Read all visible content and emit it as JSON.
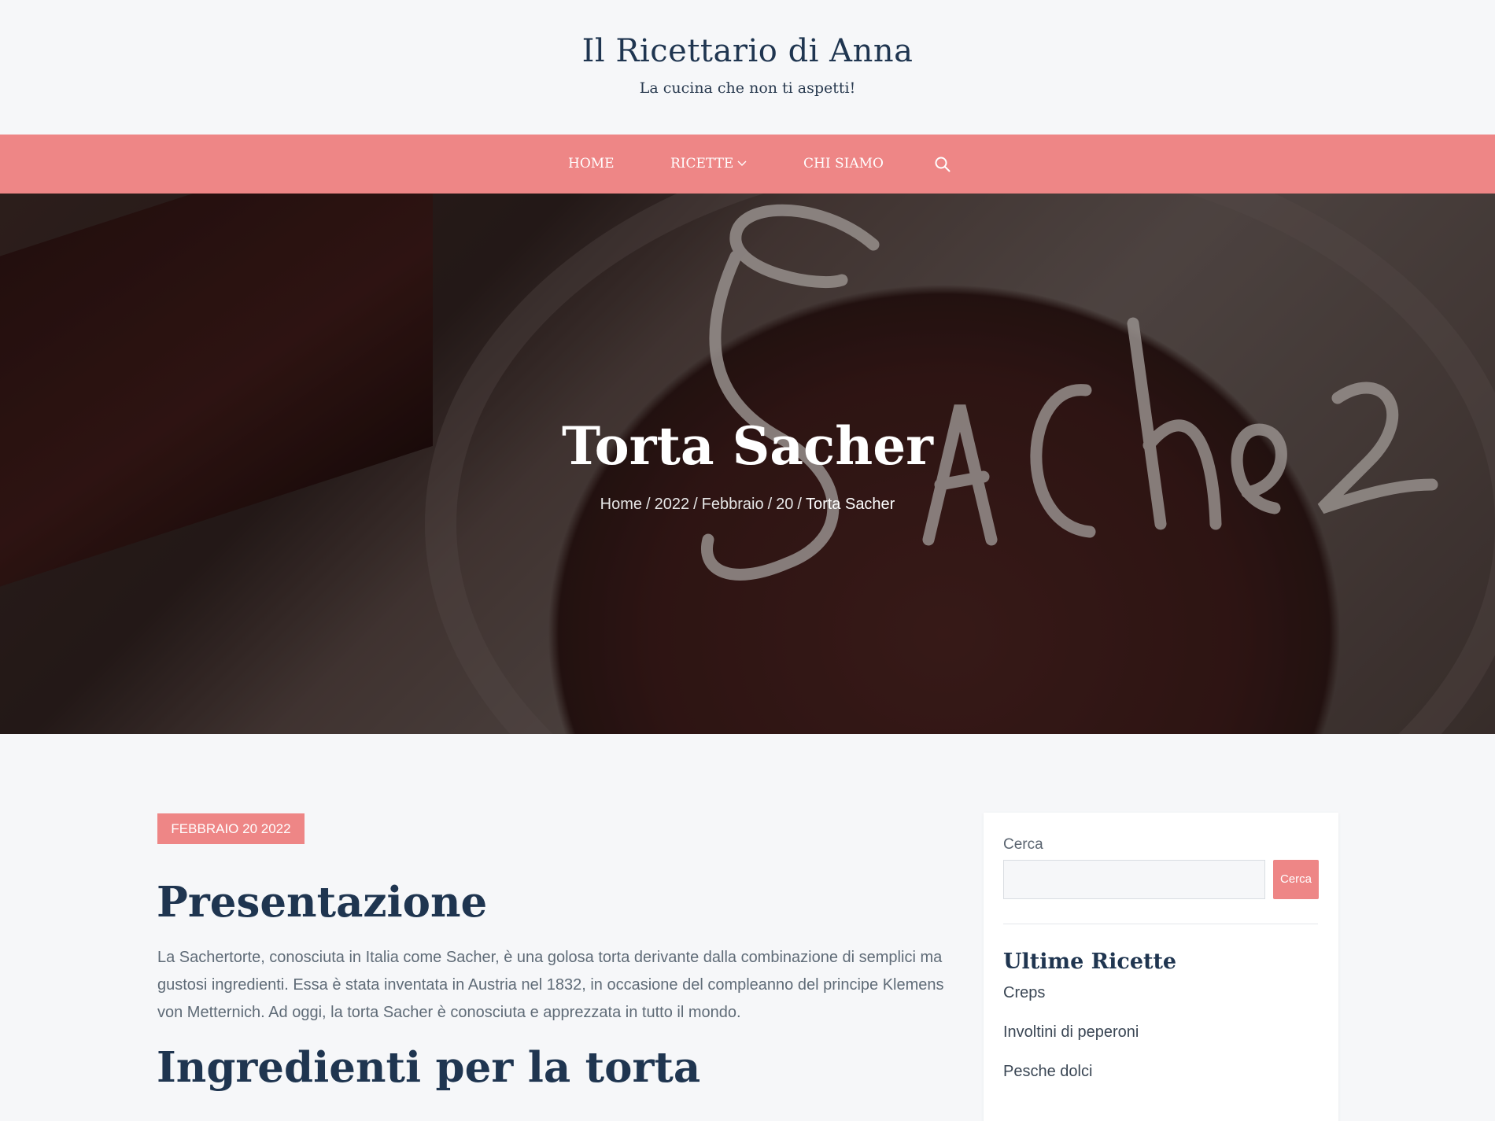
{
  "header": {
    "title": "Il Ricettario di Anna",
    "tagline": "La cucina che non ti aspetti!"
  },
  "nav": {
    "items": [
      "HOME",
      "RICETTE",
      "CHI SIAMO"
    ],
    "search_icon": "search-icon",
    "dropdown_icon": "chevron-down-icon"
  },
  "hero": {
    "title": "Torta Sacher",
    "breadcrumb": [
      "Home",
      "2022",
      "Febbraio",
      "20",
      "Torta Sacher"
    ]
  },
  "post": {
    "date": "FEBBRAIO 20 2022",
    "heading1": "Presentazione",
    "intro": "La Sachertorte, conosciuta in Italia come Sacher, è una golosa torta derivante dalla combinazione di semplici ma gustosi ingredienti. Essa è stata inventata in Austria nel 1832, in occasione del compleanno del principe Klemens von Metternich. Ad oggi, la torta Sacher è conosciuta e apprezzata in tutto il mondo.",
    "heading2": "Ingredienti per la torta"
  },
  "sidebar": {
    "search_label": "Cerca",
    "search_button": "Cerca",
    "search_value": "",
    "recent_heading": "Ultime Ricette",
    "recent": [
      "Creps",
      "Involtini di peperoni",
      "Pesche dolci"
    ]
  },
  "colors": {
    "accent": "#ee8686",
    "heading": "#1f3550",
    "background": "#f6f7f9"
  }
}
